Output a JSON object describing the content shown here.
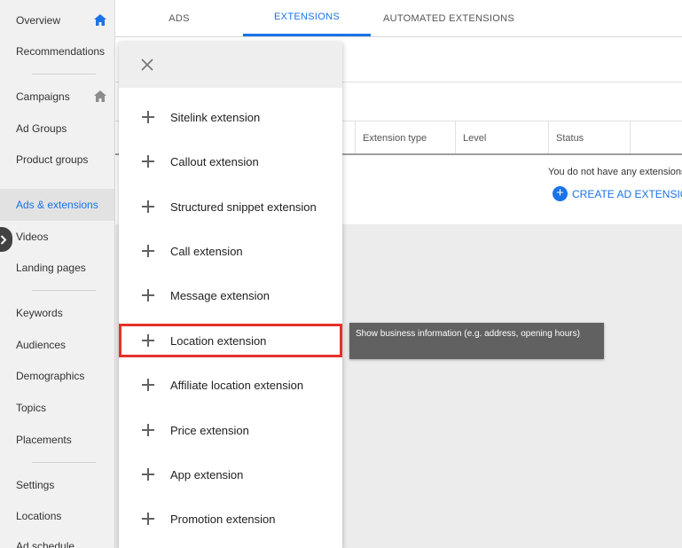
{
  "sidebar": {
    "items": [
      {
        "label": "Overview",
        "icon": "home-icon",
        "active": false
      },
      {
        "label": "Recommendations",
        "active": false
      },
      {
        "label": "Campaigns",
        "icon": "home-icon",
        "active": false
      },
      {
        "label": "Ad Groups",
        "active": false
      },
      {
        "label": "Product groups",
        "active": false
      },
      {
        "label": "Ads & extensions",
        "active": true
      },
      {
        "label": "Videos",
        "active": false
      },
      {
        "label": "Landing pages",
        "active": false
      },
      {
        "label": "Keywords",
        "active": false
      },
      {
        "label": "Audiences",
        "active": false
      },
      {
        "label": "Demographics",
        "active": false
      },
      {
        "label": "Topics",
        "active": false
      },
      {
        "label": "Placements",
        "active": false
      },
      {
        "label": "Settings",
        "active": false
      },
      {
        "label": "Locations",
        "active": false
      },
      {
        "label": "Ad schedule",
        "active": false
      }
    ],
    "collapse_icon": "chevron-right-icon"
  },
  "tabs": [
    {
      "label": "ADS",
      "active": false
    },
    {
      "label": "EXTENSIONS",
      "active": true
    },
    {
      "label": "AUTOMATED EXTENSIONS",
      "active": false
    }
  ],
  "table": {
    "headers": [
      "Extension type",
      "Level",
      "Status"
    ],
    "empty_message": "You do not have any extensions",
    "create_label": "CREATE AD EXTENSIO"
  },
  "dropdown": {
    "close_icon": "close-icon",
    "items": [
      "Sitelink extension",
      "Callout extension",
      "Structured snippet extension",
      "Call extension",
      "Message extension",
      "Location extension",
      "Affiliate location extension",
      "Price extension",
      "App extension",
      "Promotion extension"
    ],
    "highlighted_index": 5
  },
  "tooltip": {
    "text": "Show business information (e.g. address, opening hours)"
  },
  "colors": {
    "accent": "#1a73e8",
    "highlight": "#e5322b",
    "tooltip_bg": "#616161"
  }
}
